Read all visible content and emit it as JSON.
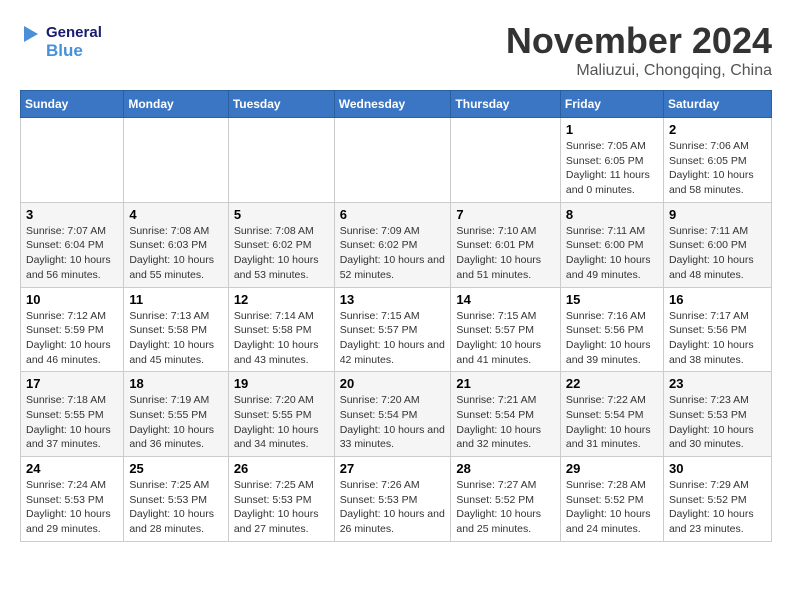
{
  "header": {
    "logo_general": "General",
    "logo_blue": "Blue",
    "month_title": "November 2024",
    "location": "Maliuzui, Chongqing, China"
  },
  "days_of_week": [
    "Sunday",
    "Monday",
    "Tuesday",
    "Wednesday",
    "Thursday",
    "Friday",
    "Saturday"
  ],
  "weeks": [
    [
      {
        "day": "",
        "info": ""
      },
      {
        "day": "",
        "info": ""
      },
      {
        "day": "",
        "info": ""
      },
      {
        "day": "",
        "info": ""
      },
      {
        "day": "",
        "info": ""
      },
      {
        "day": "1",
        "info": "Sunrise: 7:05 AM\nSunset: 6:05 PM\nDaylight: 11 hours and 0 minutes."
      },
      {
        "day": "2",
        "info": "Sunrise: 7:06 AM\nSunset: 6:05 PM\nDaylight: 10 hours and 58 minutes."
      }
    ],
    [
      {
        "day": "3",
        "info": "Sunrise: 7:07 AM\nSunset: 6:04 PM\nDaylight: 10 hours and 56 minutes."
      },
      {
        "day": "4",
        "info": "Sunrise: 7:08 AM\nSunset: 6:03 PM\nDaylight: 10 hours and 55 minutes."
      },
      {
        "day": "5",
        "info": "Sunrise: 7:08 AM\nSunset: 6:02 PM\nDaylight: 10 hours and 53 minutes."
      },
      {
        "day": "6",
        "info": "Sunrise: 7:09 AM\nSunset: 6:02 PM\nDaylight: 10 hours and 52 minutes."
      },
      {
        "day": "7",
        "info": "Sunrise: 7:10 AM\nSunset: 6:01 PM\nDaylight: 10 hours and 51 minutes."
      },
      {
        "day": "8",
        "info": "Sunrise: 7:11 AM\nSunset: 6:00 PM\nDaylight: 10 hours and 49 minutes."
      },
      {
        "day": "9",
        "info": "Sunrise: 7:11 AM\nSunset: 6:00 PM\nDaylight: 10 hours and 48 minutes."
      }
    ],
    [
      {
        "day": "10",
        "info": "Sunrise: 7:12 AM\nSunset: 5:59 PM\nDaylight: 10 hours and 46 minutes."
      },
      {
        "day": "11",
        "info": "Sunrise: 7:13 AM\nSunset: 5:58 PM\nDaylight: 10 hours and 45 minutes."
      },
      {
        "day": "12",
        "info": "Sunrise: 7:14 AM\nSunset: 5:58 PM\nDaylight: 10 hours and 43 minutes."
      },
      {
        "day": "13",
        "info": "Sunrise: 7:15 AM\nSunset: 5:57 PM\nDaylight: 10 hours and 42 minutes."
      },
      {
        "day": "14",
        "info": "Sunrise: 7:15 AM\nSunset: 5:57 PM\nDaylight: 10 hours and 41 minutes."
      },
      {
        "day": "15",
        "info": "Sunrise: 7:16 AM\nSunset: 5:56 PM\nDaylight: 10 hours and 39 minutes."
      },
      {
        "day": "16",
        "info": "Sunrise: 7:17 AM\nSunset: 5:56 PM\nDaylight: 10 hours and 38 minutes."
      }
    ],
    [
      {
        "day": "17",
        "info": "Sunrise: 7:18 AM\nSunset: 5:55 PM\nDaylight: 10 hours and 37 minutes."
      },
      {
        "day": "18",
        "info": "Sunrise: 7:19 AM\nSunset: 5:55 PM\nDaylight: 10 hours and 36 minutes."
      },
      {
        "day": "19",
        "info": "Sunrise: 7:20 AM\nSunset: 5:55 PM\nDaylight: 10 hours and 34 minutes."
      },
      {
        "day": "20",
        "info": "Sunrise: 7:20 AM\nSunset: 5:54 PM\nDaylight: 10 hours and 33 minutes."
      },
      {
        "day": "21",
        "info": "Sunrise: 7:21 AM\nSunset: 5:54 PM\nDaylight: 10 hours and 32 minutes."
      },
      {
        "day": "22",
        "info": "Sunrise: 7:22 AM\nSunset: 5:54 PM\nDaylight: 10 hours and 31 minutes."
      },
      {
        "day": "23",
        "info": "Sunrise: 7:23 AM\nSunset: 5:53 PM\nDaylight: 10 hours and 30 minutes."
      }
    ],
    [
      {
        "day": "24",
        "info": "Sunrise: 7:24 AM\nSunset: 5:53 PM\nDaylight: 10 hours and 29 minutes."
      },
      {
        "day": "25",
        "info": "Sunrise: 7:25 AM\nSunset: 5:53 PM\nDaylight: 10 hours and 28 minutes."
      },
      {
        "day": "26",
        "info": "Sunrise: 7:25 AM\nSunset: 5:53 PM\nDaylight: 10 hours and 27 minutes."
      },
      {
        "day": "27",
        "info": "Sunrise: 7:26 AM\nSunset: 5:53 PM\nDaylight: 10 hours and 26 minutes."
      },
      {
        "day": "28",
        "info": "Sunrise: 7:27 AM\nSunset: 5:52 PM\nDaylight: 10 hours and 25 minutes."
      },
      {
        "day": "29",
        "info": "Sunrise: 7:28 AM\nSunset: 5:52 PM\nDaylight: 10 hours and 24 minutes."
      },
      {
        "day": "30",
        "info": "Sunrise: 7:29 AM\nSunset: 5:52 PM\nDaylight: 10 hours and 23 minutes."
      }
    ]
  ]
}
